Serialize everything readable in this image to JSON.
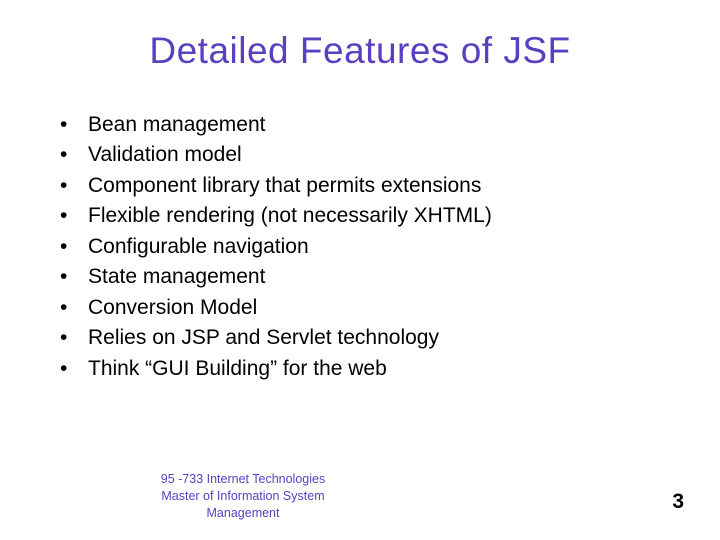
{
  "title": "Detailed Features of JSF",
  "bullets": [
    "Bean management",
    "Validation model",
    "Component library that permits extensions",
    "Flexible rendering (not necessarily XHTML)",
    "Configurable navigation",
    "State management",
    "Conversion Model",
    "Relies on JSP and Servlet technology",
    "Think “GUI Building” for the web"
  ],
  "footer": {
    "line1": "95 -733 Internet Technologies",
    "line2": "Master of Information System Management"
  },
  "page_number": "3"
}
